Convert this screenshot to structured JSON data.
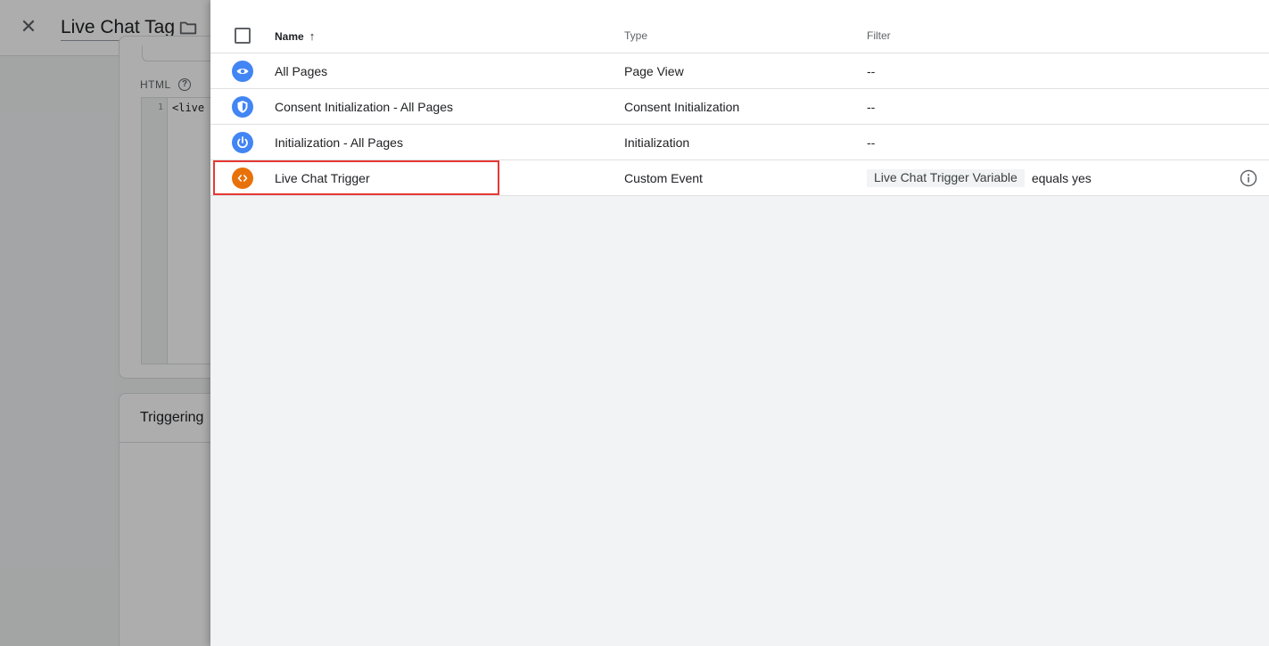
{
  "background": {
    "title": "Live Chat Tag",
    "html_label": "HTML",
    "code_line_number": "1",
    "code_text": "<live",
    "triggering_title": "Triggering"
  },
  "table": {
    "columns": {
      "name": "Name",
      "type": "Type",
      "filter": "Filter"
    },
    "rows": [
      {
        "name": "All Pages",
        "type": "Page View",
        "filter": "--",
        "icon": "eye-icon",
        "icon_color": "#4285f4"
      },
      {
        "name": "Consent Initialization - All Pages",
        "type": "Consent Initialization",
        "filter": "--",
        "icon": "shield-icon",
        "icon_color": "#4285f4"
      },
      {
        "name": "Initialization - All Pages",
        "type": "Initialization",
        "filter": "--",
        "icon": "power-icon",
        "icon_color": "#4285f4"
      },
      {
        "name": "Live Chat Trigger",
        "type": "Custom Event",
        "filter_variable": "Live Chat Trigger Variable",
        "filter_operator": "equals yes",
        "icon": "code-icon",
        "icon_color": "#e8710a"
      }
    ]
  },
  "colors": {
    "highlight": "#e53935",
    "blue_icon": "#4285f4",
    "orange_icon": "#e8710a"
  }
}
